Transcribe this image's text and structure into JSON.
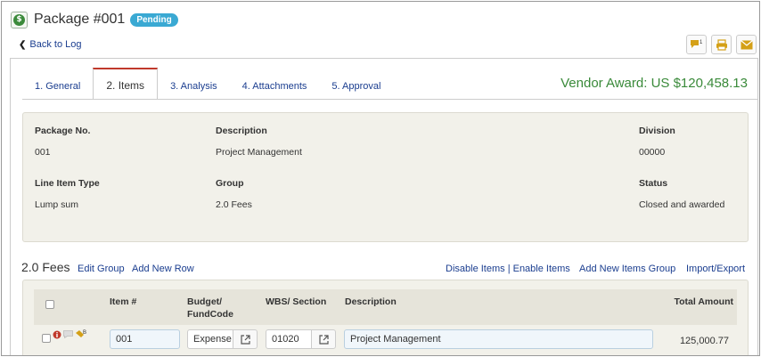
{
  "header": {
    "title": "Package #001",
    "status_badge": "Pending",
    "back_label": "Back to Log",
    "toolbar": {
      "comment_icon": "comment-icon",
      "comment_count": "1",
      "print_icon": "print-icon",
      "email_icon": "envelope-icon"
    }
  },
  "tabs": [
    {
      "label": "1. General"
    },
    {
      "label": "2. Items",
      "active": true
    },
    {
      "label": "3. Analysis"
    },
    {
      "label": "4. Attachments"
    },
    {
      "label": "5. Approval"
    }
  ],
  "vendor_award": "Vendor Award: US $120,458.13",
  "info": {
    "package_no_label": "Package No.",
    "package_no": "001",
    "description_label": "Description",
    "description": "Project Management",
    "division_label": "Division",
    "division": "00000",
    "line_item_type_label": "Line Item Type",
    "line_item_type": "Lump sum",
    "group_label": "Group",
    "group": "2.0 Fees",
    "status_label": "Status",
    "status": "Closed and awarded"
  },
  "group_section": {
    "title": "2.0 Fees",
    "edit_group": "Edit Group",
    "add_new_row": "Add New Row",
    "disable_enable": "Disable Items | Enable Items",
    "add_items_group": "Add New Items Group",
    "import_export": "Import/Export"
  },
  "table": {
    "columns": {
      "item": "Item #",
      "budget_line1": "Budget/",
      "budget_line2": "FundCode",
      "wbs": "WBS/ Section",
      "description": "Description",
      "total": "Total Amount"
    },
    "rows": [
      {
        "item_no": "001",
        "budget": "Expense",
        "wbs": "01020",
        "description": "Project Management",
        "total": "125,000.77",
        "icon_badge": "B"
      }
    ]
  },
  "colors": {
    "accent_green": "#3a8a3a",
    "link_blue": "#1a3d8f",
    "badge_blue": "#3aa9d3",
    "active_tab_red": "#c0392b",
    "toolbar_gold": "#d4a017"
  }
}
